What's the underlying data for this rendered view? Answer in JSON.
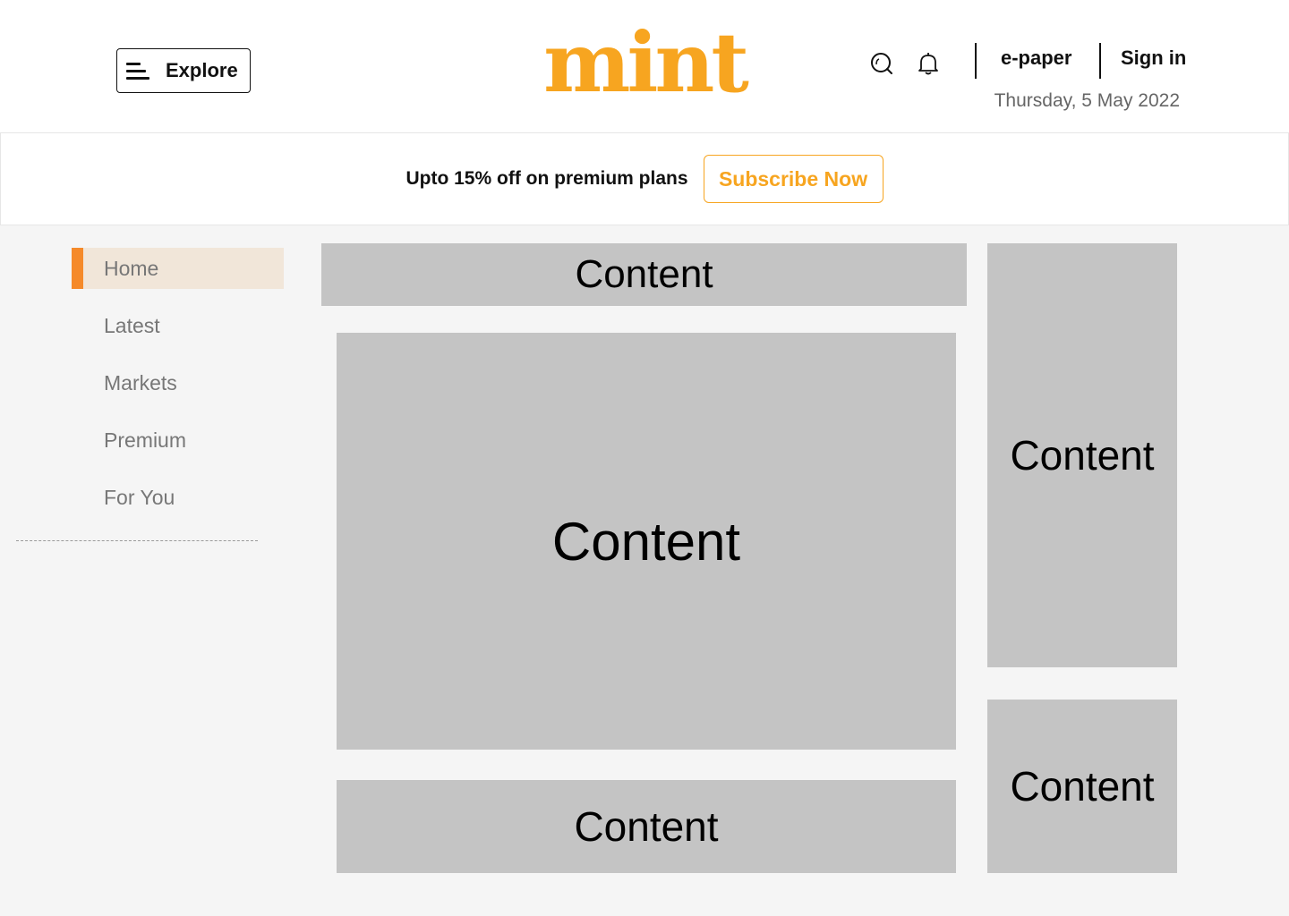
{
  "header": {
    "explore_label": "Explore",
    "logo_text": "mint",
    "epaper_label": "e-paper",
    "signin_label": "Sign in",
    "date": "Thursday, 5 May 2022",
    "icons": {
      "menu": "hamburger-menu-icon",
      "search": "search-icon",
      "notifications": "bell-icon"
    }
  },
  "promo": {
    "text": "Upto 15% off on premium plans",
    "button_label": "Subscribe Now"
  },
  "sidebar": {
    "items": [
      {
        "label": "Home",
        "active": true
      },
      {
        "label": "Latest"
      },
      {
        "label": "Markets"
      },
      {
        "label": "Premium"
      },
      {
        "label": "For You"
      }
    ]
  },
  "content_blocks": [
    "Content",
    "Content",
    "Content",
    "Content",
    "Content"
  ],
  "colors": {
    "brand": "#f7a520",
    "active_bar": "#f58a2a",
    "active_bg": "#f1e6d9",
    "placeholder": "#c4c4c4",
    "page_bg": "#f5f5f5"
  }
}
